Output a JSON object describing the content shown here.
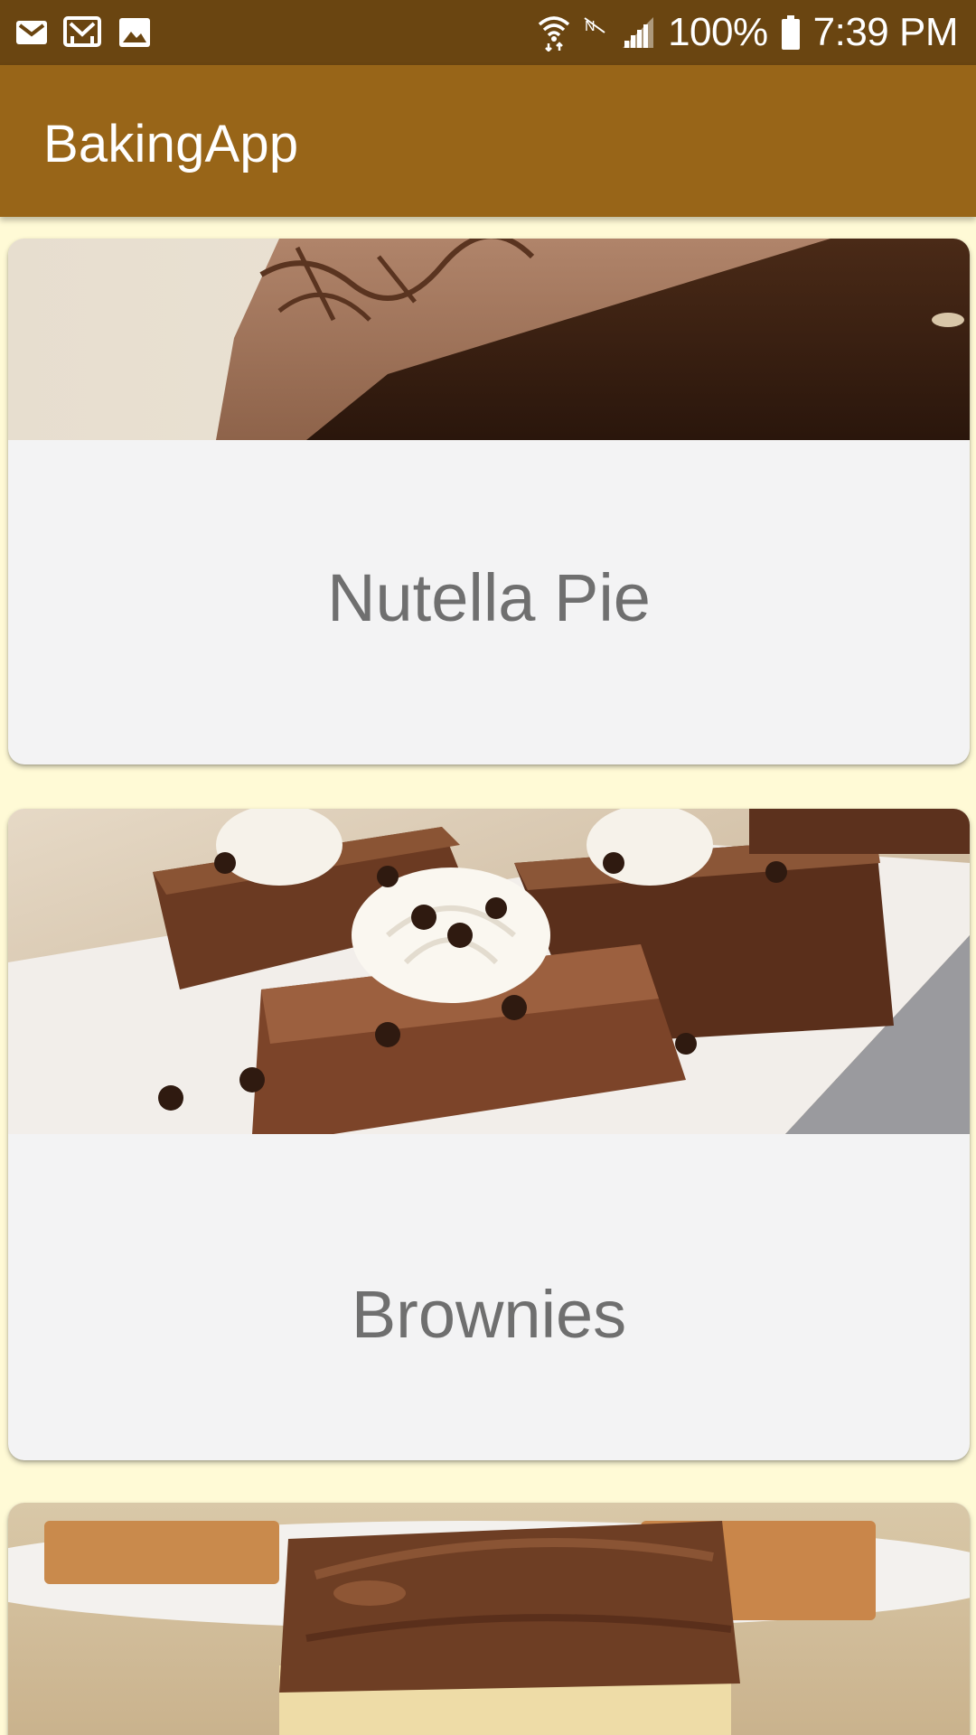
{
  "status_bar": {
    "left_icons": [
      "mail-icon",
      "mail-outline-icon",
      "image-icon"
    ],
    "right_icons": [
      "wifi-icon",
      "nfc-icon",
      "signal-icon",
      "battery-icon"
    ],
    "battery": "100%",
    "time": "7:39 PM"
  },
  "app_bar": {
    "title": "BakingApp"
  },
  "recipes": [
    {
      "name": "Nutella Pie"
    },
    {
      "name": "Brownies"
    },
    {
      "name": ""
    }
  ],
  "colors": {
    "status_bar": "#6A4511",
    "app_bar": "#986518",
    "background": "#FFFAD6",
    "card": "#F3F3F4",
    "card_text": "#6F6F6F"
  }
}
